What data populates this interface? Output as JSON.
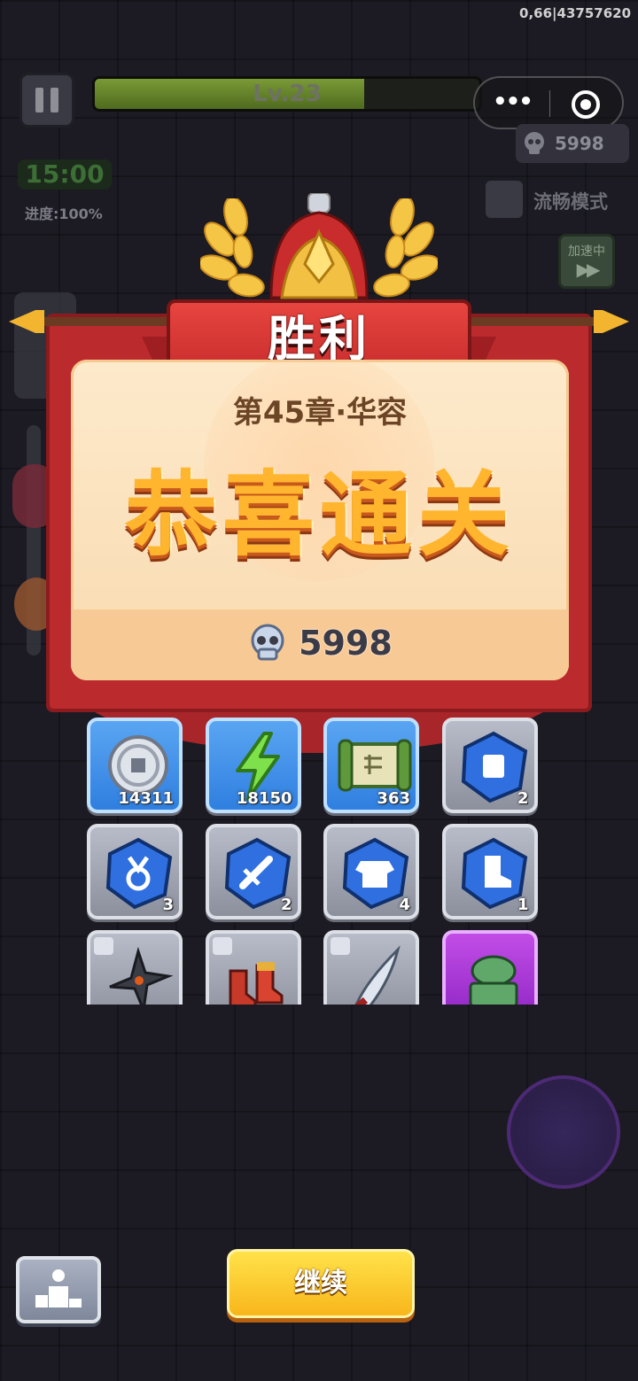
{
  "debug": {
    "text": "0,66|43757620"
  },
  "hud": {
    "level_label": "Lv.23",
    "xp_fraction": 0.7,
    "skull_count": "5998",
    "timer": "15:00",
    "progress": "进度:100%",
    "smooth_mode_label": "流畅模式",
    "speed_label": "加速中",
    "speed_arrows": "▶▶"
  },
  "mini_program": {
    "menu_dots": "•••"
  },
  "victory": {
    "banner_title": "胜利",
    "chapter": "第45章·华容",
    "headline": "恭喜通关",
    "skull_reward": "5998"
  },
  "rewards": [
    {
      "icon": "silver-coin-icon",
      "count": "14311",
      "bg": "blue"
    },
    {
      "icon": "lightning-energy-icon",
      "count": "18150",
      "bg": "blue"
    },
    {
      "icon": "scroll-map-icon",
      "count": "363",
      "bg": "blue"
    },
    {
      "icon": "blue-gem-scroll-icon",
      "count": "2",
      "bg": "gray"
    },
    {
      "icon": "blue-gem-medal-icon",
      "count": "3",
      "bg": "gray"
    },
    {
      "icon": "blue-gem-sword-icon",
      "count": "2",
      "bg": "gray"
    },
    {
      "icon": "blue-gem-armor-icon",
      "count": "4",
      "bg": "gray"
    },
    {
      "icon": "blue-gem-boot-icon",
      "count": "1",
      "bg": "gray"
    },
    {
      "icon": "shuriken-icon",
      "count": "",
      "bg": "gray"
    },
    {
      "icon": "red-boots-icon",
      "count": "",
      "bg": "gray"
    },
    {
      "icon": "curved-blade-icon",
      "count": "",
      "bg": "gray"
    },
    {
      "icon": "jade-turtle-seal-icon",
      "count": "",
      "bg": "purple"
    }
  ],
  "buttons": {
    "continue": "继续"
  },
  "colors": {
    "accent_yellow": "#f8b61b",
    "banner_red": "#c42a2a",
    "panel_cream": "#fdeacb",
    "gem_blue": "#2f7fe0"
  }
}
